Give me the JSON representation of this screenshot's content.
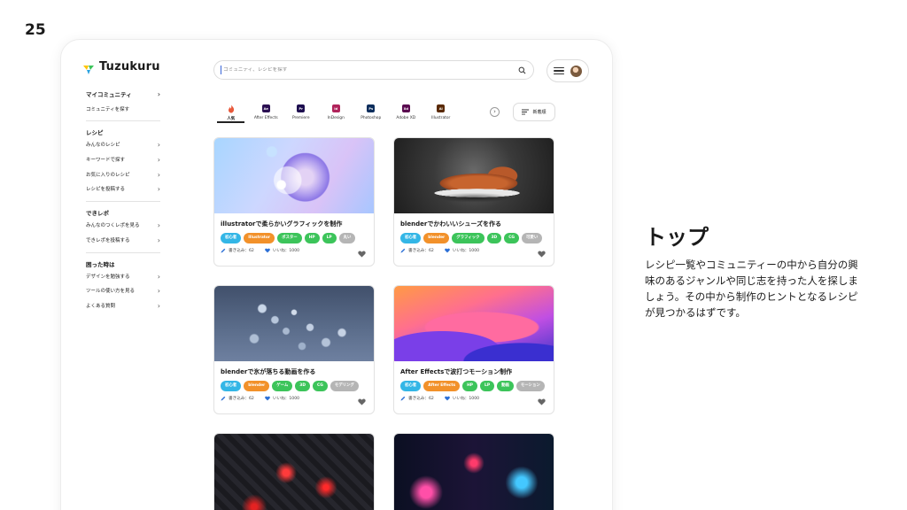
{
  "slide_number": "25",
  "app": {
    "logo_text": "Tuzukuru"
  },
  "sidebar": {
    "top_items": [
      {
        "label": "マイコミュニティ",
        "bold": true
      },
      {
        "label": "コミュニティを探す"
      }
    ],
    "sections": [
      {
        "title": "レシピ",
        "items": [
          "みんなのレシピ",
          "キーワードで探す",
          "お気に入りのレシピ",
          "レシピを投稿する"
        ]
      },
      {
        "title": "できレポ",
        "items": [
          "みんなのつくレポを見る",
          "できレポを投稿する"
        ]
      },
      {
        "title": "困った時は",
        "items": [
          "デザインを勉強する",
          "ツールの使い方を見る",
          "よくある質問"
        ]
      }
    ]
  },
  "search": {
    "placeholder": "コミュニティ、レシピを探す"
  },
  "tabs": [
    {
      "label": "人気",
      "icon": "flame-icon",
      "color": "#e8593b",
      "active": true
    },
    {
      "label": "After Effects",
      "abbr": "Ae",
      "color": "#2b1052"
    },
    {
      "label": "Premiere",
      "abbr": "Pr",
      "color": "#1d0e4f"
    },
    {
      "label": "InDesign",
      "abbr": "Id",
      "color": "#b0245b"
    },
    {
      "label": "Photoshop",
      "abbr": "Ps",
      "color": "#0c2d5c"
    },
    {
      "label": "Adobe XD",
      "abbr": "Xd",
      "color": "#5a0a4f"
    },
    {
      "label": "Illustrator",
      "abbr": "Ai",
      "color": "#5a2a06"
    }
  ],
  "sort_button": {
    "label": "新着順"
  },
  "cards": [
    {
      "title": "illustratorで柔らかいグラフィックを制作",
      "tags": [
        {
          "label": "初心者",
          "color": "#33b6e6"
        },
        {
          "label": "Illustrator",
          "color": "#f2912a"
        },
        {
          "label": "ポスター",
          "color": "#3cc45a"
        },
        {
          "label": "HP",
          "color": "#3cc45a"
        },
        {
          "label": "LP",
          "color": "#3cc45a"
        },
        {
          "label": "丸い",
          "color": "#b5b5b5"
        }
      ],
      "writes": "書き込み：62",
      "likes": "いいね：1000"
    },
    {
      "title": "blenderでかわいいシューズを作る",
      "tags": [
        {
          "label": "初心者",
          "color": "#33b6e6"
        },
        {
          "label": "blender",
          "color": "#f2912a"
        },
        {
          "label": "グラフィック",
          "color": "#3cc45a"
        },
        {
          "label": "3D",
          "color": "#3cc45a"
        },
        {
          "label": "CG",
          "color": "#3cc45a"
        },
        {
          "label": "可愛い",
          "color": "#b5b5b5"
        }
      ],
      "writes": "書き込み：62",
      "likes": "いいね：1000"
    },
    {
      "title": "blenderで氷が落ちる動画を作る",
      "tags": [
        {
          "label": "初心者",
          "color": "#33b6e6"
        },
        {
          "label": "blender",
          "color": "#f2912a"
        },
        {
          "label": "ゲーム",
          "color": "#3cc45a"
        },
        {
          "label": "3D",
          "color": "#3cc45a"
        },
        {
          "label": "CG",
          "color": "#3cc45a"
        },
        {
          "label": "モデリング",
          "color": "#b5b5b5"
        }
      ],
      "writes": "書き込み：62",
      "likes": "いいね：1000"
    },
    {
      "title": "After Effectsで波打つモーション制作",
      "tags": [
        {
          "label": "初心者",
          "color": "#33b6e6"
        },
        {
          "label": "After Effects",
          "color": "#f2912a"
        },
        {
          "label": "HP",
          "color": "#3cc45a"
        },
        {
          "label": "LP",
          "color": "#3cc45a"
        },
        {
          "label": "動画",
          "color": "#3cc45a"
        },
        {
          "label": "モーション",
          "color": "#b5b5b5"
        }
      ],
      "writes": "書き込み：62",
      "likes": "いいね：1000"
    }
  ],
  "description": {
    "heading": "トップ",
    "body": "レシピ一覧やコミュニティーの中から自分の興味のあるジャンルや同じ志を持った人を探しましょう。その中から制作のヒントとなるレシピが見つかるはずです。"
  }
}
